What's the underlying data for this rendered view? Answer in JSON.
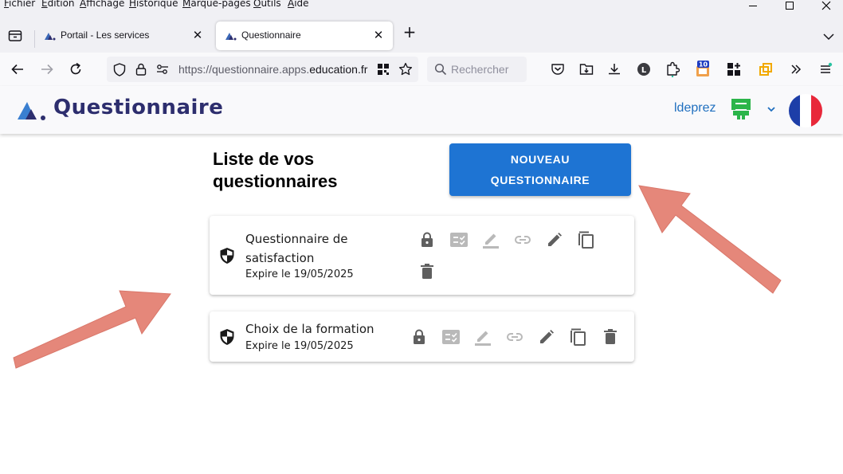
{
  "menu": [
    "Fichier",
    "Edition",
    "Affichage",
    "Historique",
    "Marque-pages",
    "Outils",
    "Aide"
  ],
  "menu_underline": [
    "F",
    "E",
    "A",
    "H",
    "M",
    "O",
    "A"
  ],
  "tabs": [
    {
      "title": "Portail - Les services"
    },
    {
      "title": "Questionnaire"
    }
  ],
  "url": {
    "prefix": "https://questionnaire.apps.",
    "domain": "education.fr"
  },
  "search": {
    "placeholder": "Rechercher"
  },
  "toolbar_badge": "10",
  "app": {
    "title": "Questionnaire",
    "user": "ldeprez"
  },
  "page": {
    "heading": "Liste de vos questionnaires",
    "new_button": "NOUVEAU QUESTIONNAIRE"
  },
  "questionnaires": [
    {
      "title": "Questionnaire de satisfaction",
      "expiry": "Expire le 19/05/2025"
    },
    {
      "title": "Choix de la formation",
      "expiry": "Expire le 19/05/2025"
    }
  ],
  "colors": {
    "primary_button": "#1e74d3",
    "app_title": "#2d2e6e",
    "user_link": "#1f6fbf",
    "arrow": "#e5877a"
  }
}
